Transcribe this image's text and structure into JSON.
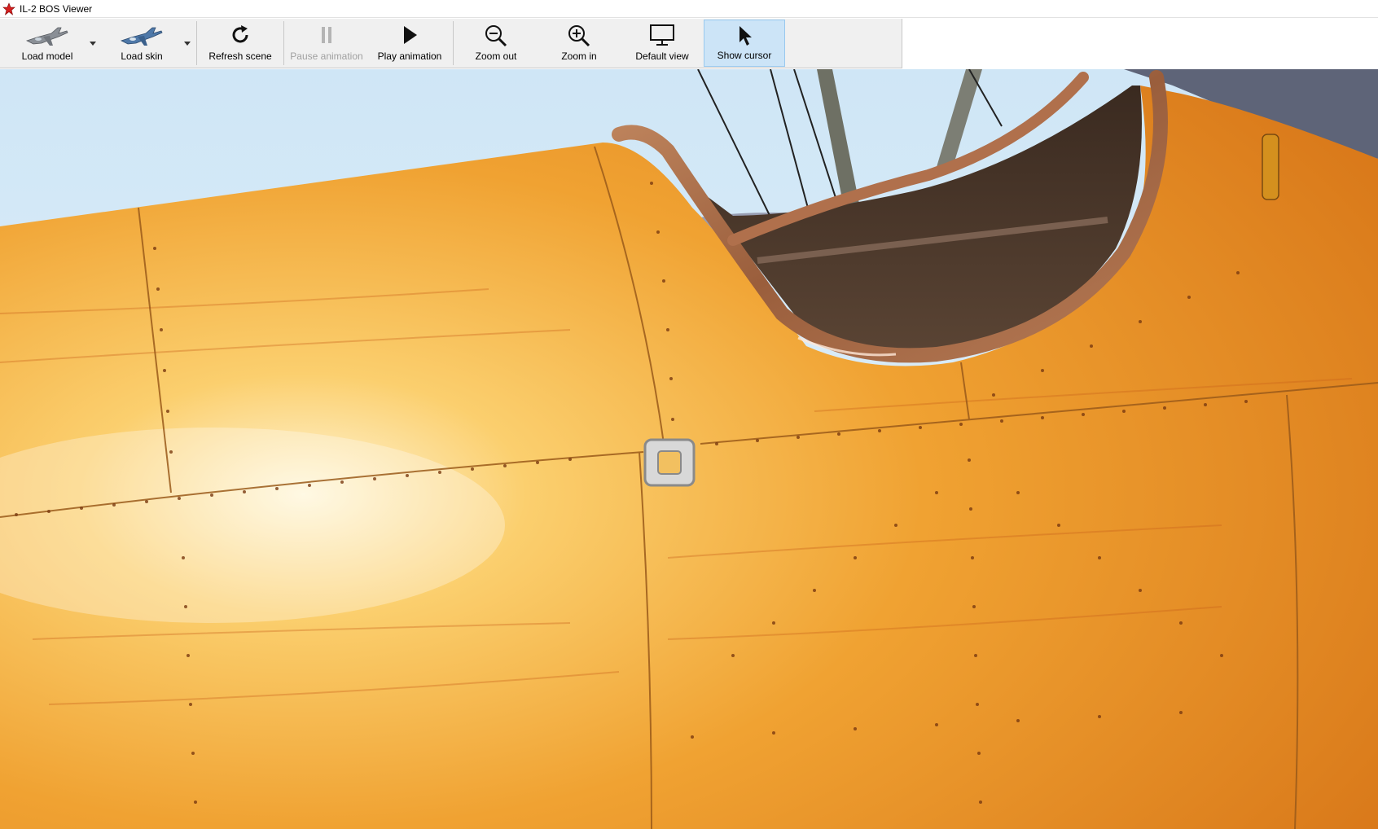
{
  "window": {
    "title": "IL-2 BOS Viewer"
  },
  "toolbar": {
    "load_model": "Load model",
    "load_skin": "Load skin",
    "refresh_scene": "Refresh scene",
    "pause_animation": "Pause animation",
    "play_animation": "Play animation",
    "zoom_out": "Zoom out",
    "zoom_in": "Zoom in",
    "default_view": "Default view",
    "show_cursor": "Show cursor"
  },
  "icons": {
    "load_model": "airplane-icon",
    "load_skin": "airplane-skin-icon",
    "refresh_scene": "refresh-icon",
    "pause_animation": "pause-icon",
    "play_animation": "play-icon",
    "zoom_out": "zoom-out-icon",
    "zoom_in": "zoom-in-icon",
    "default_view": "monitor-icon",
    "show_cursor": "cursor-arrow-icon"
  },
  "state": {
    "pause_enabled": false,
    "show_cursor_active": true
  },
  "colors": {
    "toolbar_bg": "#f0f0f0",
    "active_bg": "#cce4f7",
    "sky": "#d8ecf8",
    "wood": "#f0a030",
    "leather": "#a86a48"
  }
}
